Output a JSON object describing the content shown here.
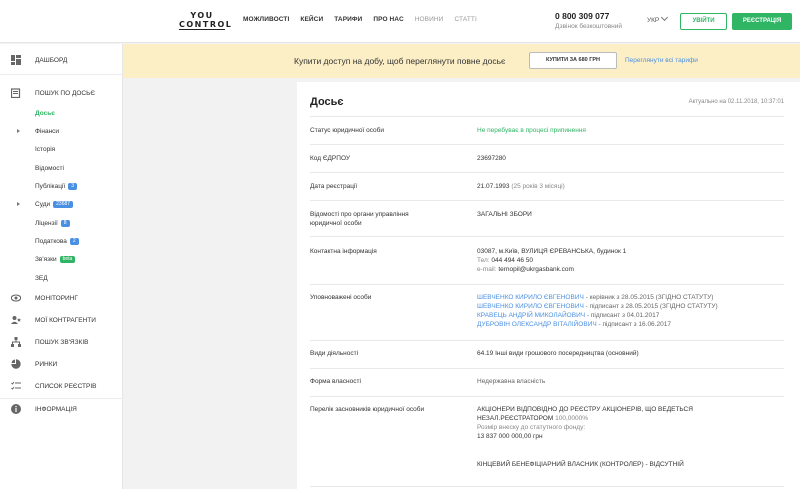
{
  "header": {
    "logo_top": "YOU",
    "logo_bottom": "CONTROL",
    "nav": [
      "МОЖЛИВОСТІ",
      "КЕЙСИ",
      "ТАРИФИ",
      "ПРО НАС",
      "НОВИНИ",
      "СТАТТІ"
    ],
    "phone": "0 800 309 077",
    "phone_sub": "Дзвінок безкоштовний",
    "lang": "УКР",
    "login": "УВІЙТИ",
    "register": "РЕЄСТРАЦІЯ"
  },
  "sidebar": {
    "dashboard": "ДАШБОРД",
    "search": "ПОШУК ПО ДОСЬЄ",
    "sub": {
      "dossier": "Досьє",
      "finance": "Фінанси",
      "history": "Історія",
      "info": "Відомості",
      "publications": "Публікації",
      "publications_badge": "3",
      "courts": "Суди",
      "courts_badge": "23687",
      "licenses": "Ліцензії",
      "licenses_badge": "8",
      "tax": "Податкова",
      "tax_badge": "2",
      "links": "Зв'язки",
      "links_badge": "beta",
      "zed": "ЗЕД"
    },
    "monitoring": "МОНІТОРИНГ",
    "contractors": "МОЇ КОНТРАГЕНТИ",
    "search_links": "ПОШУК ЗВ'ЯЗКІВ",
    "markets": "РИНКИ",
    "registries": "СПИСОК РЕЄСТРІВ",
    "information": "ІНФОРМАЦІЯ"
  },
  "banner": {
    "text": "Купити доступ на добу, щоб переглянути повне досьє",
    "button": "КУПИТИ ЗА 680 ГРН",
    "link": "Переглянути всі тарифи"
  },
  "card": {
    "title": "Досьє",
    "updated": "Актуально на 02.11.2018, 10:37:01",
    "rows": {
      "status_label": "Статус юридичної особи",
      "status_value": "Не перебуває в процесі припинення",
      "code_label": "Код ЄДРПОУ",
      "code_value": "23697280",
      "date_label": "Дата реєстрації",
      "date_value": "21.07.1993",
      "date_age": "(25 років 3 місяці)",
      "gov_label_1": "Відомості про органи управління",
      "gov_label_2": "юридичної особи",
      "gov_value": "ЗАГАЛЬНІ ЗБОРИ",
      "contact_label": "Контактна інформація",
      "contact_address": "03087, м.Київ, ВУЛИЦЯ ЄРЕВАНСЬКА, будинок 1",
      "contact_tel_label": "Тел:",
      "contact_tel": "044 494 46 50",
      "contact_email_label": "e-mail:",
      "contact_email": "ternopil@ukrgasbank.com",
      "auth_label": "Уповноважені особи",
      "auth": [
        {
          "name": "ШЕВЧЕНКО КИРИЛО ЄВГЕНОВИЧ",
          "role": " - керівник з 28.05.2015 (ЗГІДНО СТАТУТУ)"
        },
        {
          "name": "ШЕВЧЕНКО КИРИЛО ЄВГЕНОВИЧ",
          "role": " - підписант з 28.05.2015 (ЗГІДНО СТАТУТУ)"
        },
        {
          "name": "КРАВЕЦЬ АНДРІЙ МИКОЛАЙОВИЧ",
          "role": " - підписант з 04.01.2017"
        },
        {
          "name": "ДУБРОВІН ОЛЕКСАНДР ВІТАЛІЙОВИЧ",
          "role": " - підписант з 16.06.2017"
        }
      ],
      "activity_label": "Види діяльності",
      "activity_value": "64.19 Інші види грошового посередництва (основний)",
      "ownership_label": "Форма власності",
      "ownership_value": "Недержавна власність",
      "founders_label": "Перелік засновників юридичної особи",
      "founders_line1": "АКЦІОНЕРИ ВІДПОВІДНО ДО РЕЄСТРУ АКЦІОНЕРІВ, ЩО ВЕДЕТЬСЯ",
      "founders_line2": "НЕЗАЛ.РЕЄСТРАТОРОМ",
      "founders_pct": "100,0000%",
      "founders_capital_label": "Розмір внеску до статутного фонду:",
      "founders_capital": "13 837 000 000,00 грн",
      "beneficiary": "КІНЦЕВИЙ БЕНЕФІЦІАРНИЙ ВЛАСНИК (КОНТРОЛЕР) - ВІДСУТНІЙ"
    }
  }
}
